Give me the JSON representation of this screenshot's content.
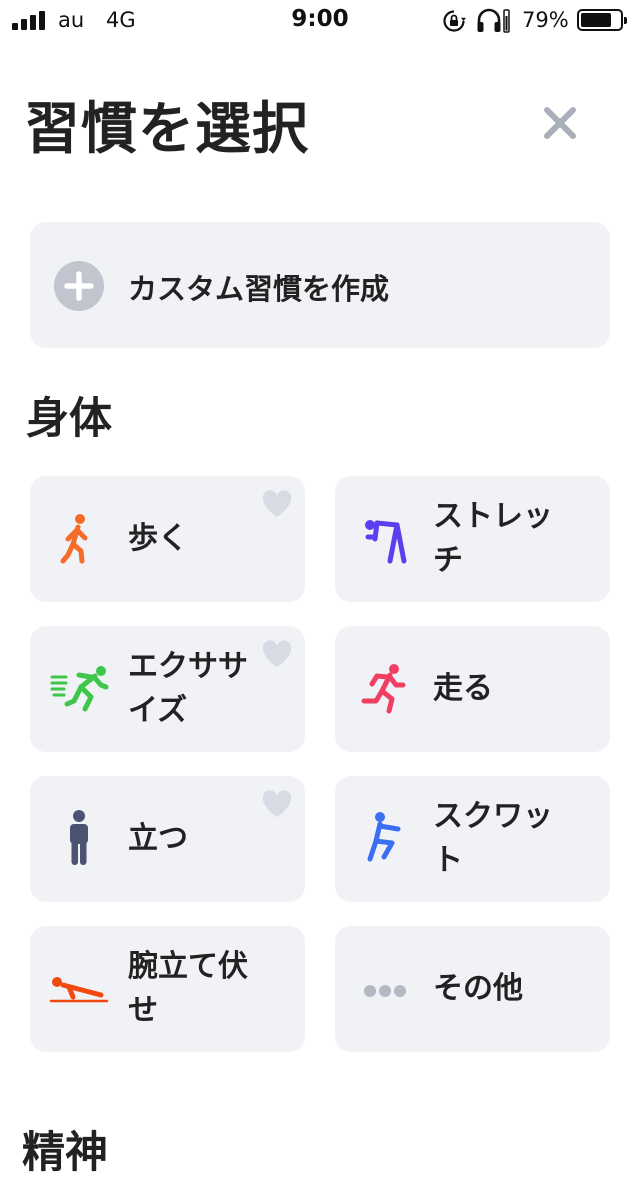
{
  "status_bar": {
    "carrier": "au",
    "network": "4G",
    "time": "9:00",
    "battery": "79%",
    "battery_level": 0.79
  },
  "header": {
    "title": "習慣を選択"
  },
  "custom": {
    "label": "カスタム習慣を作成"
  },
  "section_body": {
    "title": "身体"
  },
  "section_next": {
    "title": "精神"
  },
  "habits": [
    {
      "label": "歩く",
      "icon": "walking-person-icon",
      "color": "#f56b28",
      "favorite": true
    },
    {
      "label": "ストレッチ",
      "icon": "stretching-person-icon",
      "color": "#5e3ff0",
      "favorite": false
    },
    {
      "label": "エクササイズ",
      "icon": "exercise-person-icon",
      "color": "#3ec64a",
      "favorite": true
    },
    {
      "label": "走る",
      "icon": "running-person-icon",
      "color": "#f23e63",
      "favorite": false
    },
    {
      "label": "立つ",
      "icon": "standing-person-icon",
      "color": "#4b5370",
      "favorite": true
    },
    {
      "label": "スクワット",
      "icon": "squat-person-icon",
      "color": "#3a6ff2",
      "favorite": false
    },
    {
      "label": "腕立て伏せ",
      "icon": "pushup-person-icon",
      "color": "#f2490f",
      "favorite": false
    },
    {
      "label": "その他",
      "icon": "more-dots-icon",
      "color": "#b3b8c2",
      "favorite": false
    }
  ]
}
